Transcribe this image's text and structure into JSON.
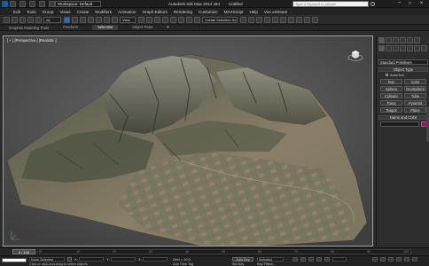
{
  "title_bar": {
    "workspace": "Workspace: Default",
    "app_title": "Autodesk 3ds Max  2014 x64",
    "doc_title": "Untitled",
    "search_placeholder": "Type a keyword or phrase"
  },
  "menu": [
    "Edit",
    "Tools",
    "Group",
    "Views",
    "Create",
    "Modifiers",
    "Animation",
    "Graph Editors",
    "Rendering",
    "Customize",
    "MAXScript",
    "Help",
    "Vue xStream"
  ],
  "toolbar": {
    "selection_filter": "All",
    "ref_coord": "View",
    "named_selection": "Create Selection Se"
  },
  "ribbon": {
    "title": "Graphite Modeling Tools",
    "tabs": [
      "Freeform",
      "Selection",
      "Object Paint"
    ],
    "active_tab": "Selection"
  },
  "viewport": {
    "label": "[ + ] [Perspective ] [Realistic ]"
  },
  "command_panel": {
    "dropdown": "Standard Primitives",
    "object_type_title": "Object Type",
    "autogrid": "AutoGrid",
    "buttons": [
      "Box",
      "Cone",
      "Sphere",
      "GeoSphere",
      "Cylinder",
      "Tube",
      "Torus",
      "Pyramid",
      "Teapot",
      "Plane"
    ],
    "name_color_title": "Name and Color",
    "swatch_color": "#b1006a"
  },
  "timeline": {
    "frame": "0 / 100",
    "ticks": [
      "0",
      "10",
      "20",
      "30",
      "40",
      "50",
      "60",
      "70",
      "80",
      "90",
      "100"
    ]
  },
  "status": {
    "selection": "None Selected",
    "hint": "Click or click-and-drag to select objects",
    "x_label": "X:",
    "y_label": "Y:",
    "z_label": "Z:",
    "grid": "Grid = 10.0",
    "add_time_tag": "Add Time Tag",
    "auto_key": "Auto Key",
    "selected_mode": "Selected",
    "set_key": "Set Key",
    "key_filters": "Key Filters..."
  },
  "colors": {
    "accent_blue": "#1f6fd0",
    "panel_bg": "#2d2d2d"
  }
}
